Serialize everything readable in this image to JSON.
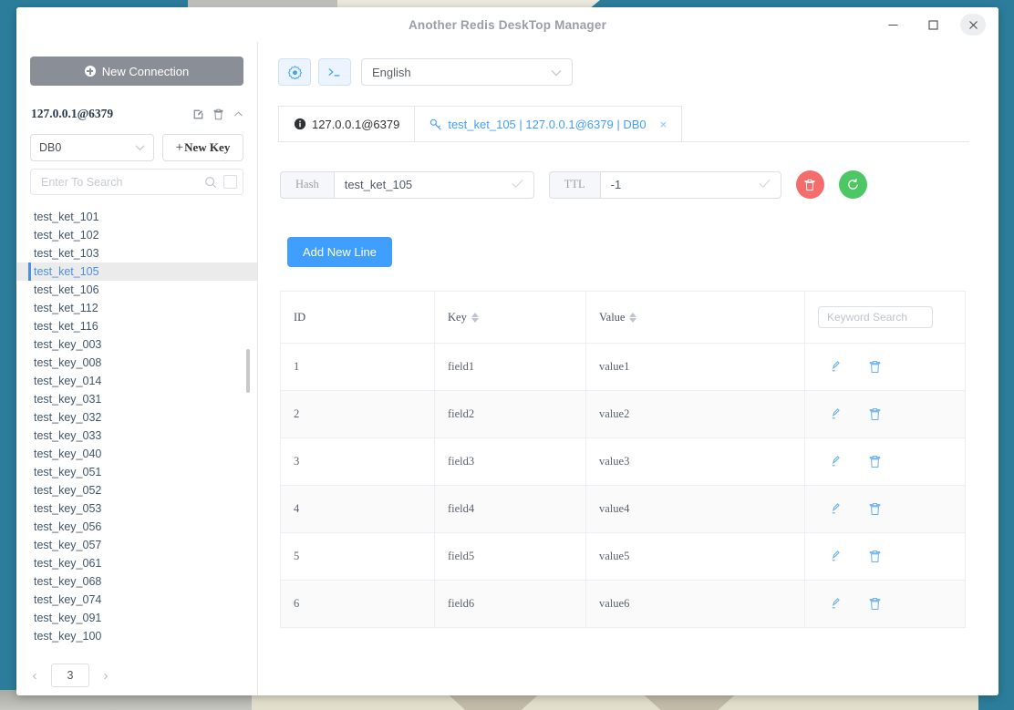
{
  "window": {
    "title": "Another Redis DeskTop Manager",
    "minimize_label": "—",
    "maximize_label": "□",
    "close_label": "×"
  },
  "sidebar": {
    "new_connection_label": "New Connection",
    "connection_name": "127.0.0.1@6379",
    "connection_actions": [
      "edit-icon",
      "delete-icon",
      "collapse-icon"
    ],
    "db_selected": "DB0",
    "new_key_label": "New Key",
    "search_placeholder": "Enter To Search",
    "keys": [
      "test_ket_101",
      "test_ket_102",
      "test_ket_103",
      "test_ket_105",
      "test_ket_106",
      "test_ket_112",
      "test_ket_116",
      "test_key_003",
      "test_key_008",
      "test_key_014",
      "test_key_031",
      "test_key_032",
      "test_key_033",
      "test_key_040",
      "test_key_051",
      "test_key_052",
      "test_key_053",
      "test_key_056",
      "test_key_057",
      "test_key_061",
      "test_key_068",
      "test_key_074",
      "test_key_091",
      "test_key_100"
    ],
    "active_key": "test_ket_105",
    "pager": {
      "prev_label": "‹",
      "page": "3",
      "next_label": "›"
    }
  },
  "toolbar": {
    "settings_icon": "gear-icon",
    "console_icon": "terminal-icon",
    "language_selected": "English"
  },
  "tabs": [
    {
      "label": "127.0.0.1@6379",
      "icon": "info-icon",
      "active": false,
      "closable": false
    },
    {
      "label": "test_ket_105 | 127.0.0.1@6379 | DB0",
      "icon": "key-icon",
      "active": true,
      "closable": true,
      "close_label": "×"
    }
  ],
  "key_detail": {
    "type_label": "Hash",
    "key_name": "test_ket_105",
    "ttl_label": "TTL",
    "ttl_value": "-1",
    "delete_button": "delete-icon",
    "refresh_button": "refresh-icon",
    "add_new_line_label": "Add New Line"
  },
  "table": {
    "columns": [
      "ID",
      "Key",
      "Value"
    ],
    "sortable": [
      false,
      true,
      true
    ],
    "keyword_search_placeholder": "Keyword Search",
    "rows": [
      {
        "id": "1",
        "key": "field1",
        "value": "value1"
      },
      {
        "id": "2",
        "key": "field2",
        "value": "value2"
      },
      {
        "id": "3",
        "key": "field3",
        "value": "value3"
      },
      {
        "id": "4",
        "key": "field4",
        "value": "value4"
      },
      {
        "id": "5",
        "key": "field5",
        "value": "value5"
      },
      {
        "id": "6",
        "key": "field6",
        "value": "value6"
      }
    ],
    "row_actions": [
      "edit-icon",
      "delete-icon"
    ]
  },
  "colors": {
    "desktop": "#2c7d9c",
    "accent": "#409eff",
    "danger": "#f56c6c",
    "success": "#4cc764",
    "sidebar_button": "#8a8e96"
  }
}
